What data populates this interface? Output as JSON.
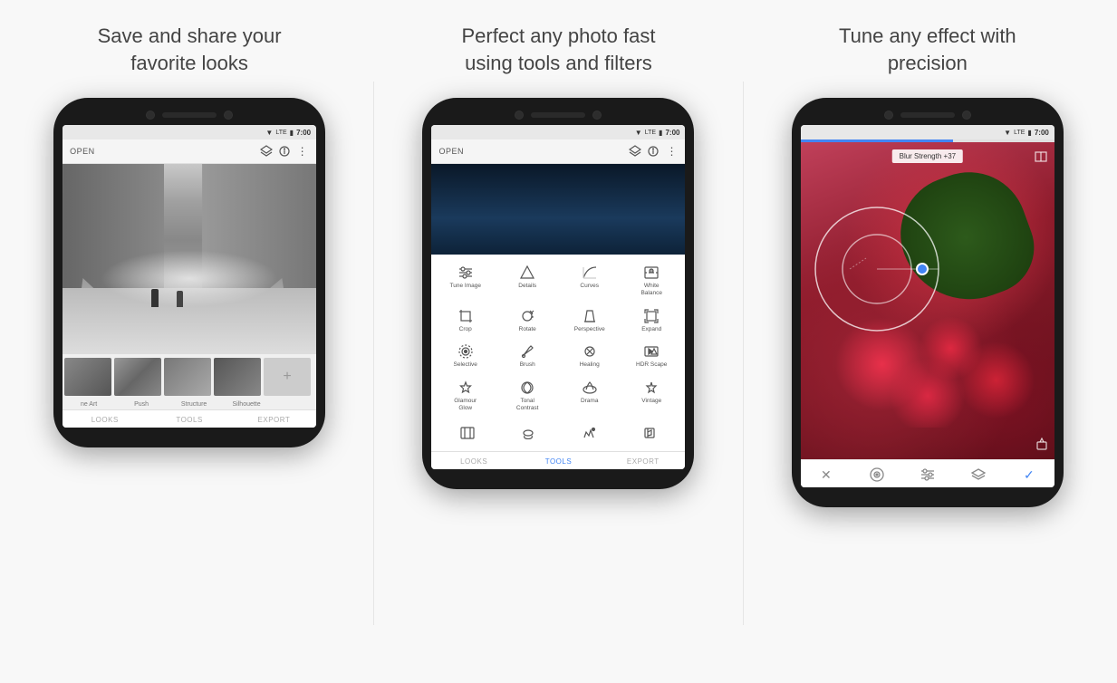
{
  "sections": [
    {
      "id": "section-1",
      "title": "Save and share your\nfavorite looks",
      "phone": {
        "time": "7:00",
        "header": {
          "open_label": "OPEN"
        },
        "thumbnails": [
          "ne Art",
          "Push",
          "Structure",
          "Silhouette"
        ],
        "nav": [
          {
            "label": "LOOKS",
            "active": false
          },
          {
            "label": "TOOLS",
            "active": false
          },
          {
            "label": "EXPORT",
            "active": false
          }
        ]
      }
    },
    {
      "id": "section-2",
      "title": "Perfect any photo fast\nusing tools and filters",
      "phone": {
        "time": "7:00",
        "header": {
          "open_label": "OPEN"
        },
        "tools": [
          {
            "label": "Tune Image",
            "icon": "tune-icon"
          },
          {
            "label": "Details",
            "icon": "details-icon"
          },
          {
            "label": "Curves",
            "icon": "curves-icon"
          },
          {
            "label": "White\nBalance",
            "icon": "white-balance-icon"
          },
          {
            "label": "Crop",
            "icon": "crop-icon"
          },
          {
            "label": "Rotate",
            "icon": "rotate-icon"
          },
          {
            "label": "Perspective",
            "icon": "perspective-icon"
          },
          {
            "label": "Expand",
            "icon": "expand-icon"
          },
          {
            "label": "Selective",
            "icon": "selective-icon"
          },
          {
            "label": "Brush",
            "icon": "brush-icon"
          },
          {
            "label": "Healing",
            "icon": "healing-icon"
          },
          {
            "label": "HDR Scape",
            "icon": "hdr-icon"
          },
          {
            "label": "Glamour\nGlow",
            "icon": "glamour-icon"
          },
          {
            "label": "Tonal\nContrast",
            "icon": "tonal-icon"
          },
          {
            "label": "Drama",
            "icon": "drama-icon"
          },
          {
            "label": "Vintage",
            "icon": "vintage-icon"
          }
        ],
        "nav": [
          {
            "label": "LOOKS",
            "active": false
          },
          {
            "label": "TOOLS",
            "active": true
          },
          {
            "label": "EXPORT",
            "active": false
          }
        ]
      }
    },
    {
      "id": "section-3",
      "title": "Tune any effect with\nprecision",
      "phone": {
        "time": "7:00",
        "blur_label": "Blur Strength +37",
        "toolbar_icons": [
          "cancel",
          "circle-target",
          "sliders",
          "layers",
          "confirm"
        ]
      }
    }
  ]
}
